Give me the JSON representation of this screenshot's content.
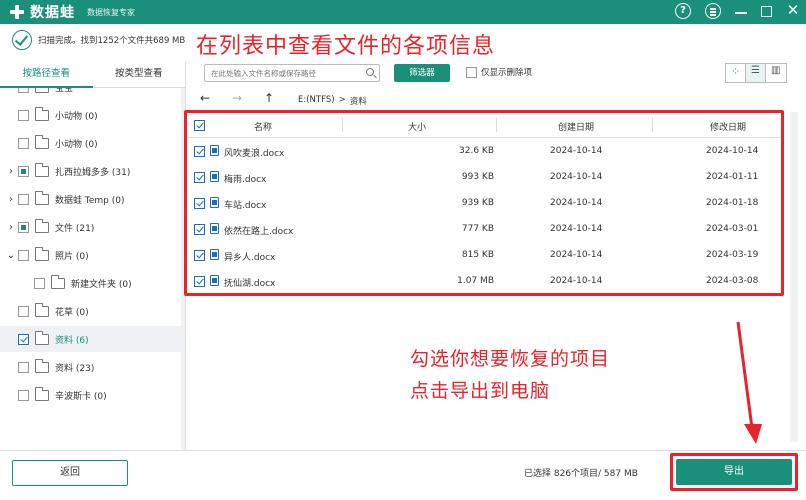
{
  "app": {
    "name": "数据蛙",
    "subtitle": "数据恢复专家"
  },
  "scan": {
    "status": "扫描完成。找到1252个文件共689 MB"
  },
  "annotations": {
    "top": "在列表中查看文件的各项信息",
    "line1": "勾选你想要恢复的项目",
    "line2": "点击导出到电脑"
  },
  "tabs": [
    {
      "label": "按路径查看",
      "active": true
    },
    {
      "label": "按类型查看",
      "active": false
    }
  ],
  "tree": [
    {
      "label": "宝宝",
      "arrow": "",
      "check": "none",
      "indent": 0
    },
    {
      "label": "小动物 (0)",
      "arrow": "",
      "check": "none",
      "indent": 0
    },
    {
      "label": "小动物 (0)",
      "arrow": "",
      "check": "none",
      "indent": 0
    },
    {
      "label": "扎西拉姆多多 (31)",
      "arrow": "›",
      "check": "partial",
      "indent": 0
    },
    {
      "label": "数据蛙 Temp (0)",
      "arrow": "›",
      "check": "none",
      "indent": 0
    },
    {
      "label": "文件 (21)",
      "arrow": "›",
      "check": "partial",
      "indent": 0
    },
    {
      "label": "照片 (0)",
      "arrow": "⌄",
      "check": "none",
      "indent": 0
    },
    {
      "label": "新建文件夹 (0)",
      "arrow": "",
      "check": "none",
      "indent": 1
    },
    {
      "label": "花草 (0)",
      "arrow": "",
      "check": "none",
      "indent": 0
    },
    {
      "label": "资料 (6)",
      "arrow": "",
      "check": "checked",
      "indent": 0,
      "selected": true
    },
    {
      "label": "资料 (23)",
      "arrow": "",
      "check": "none",
      "indent": 0
    },
    {
      "label": "辛波斯卡 (0)",
      "arrow": "",
      "check": "none",
      "indent": 0
    }
  ],
  "toolbar": {
    "search_placeholder": "在此处输入文件名称或保存路径",
    "filter_label": "筛选器",
    "deleted_only_label": "仅显示删除项"
  },
  "nav": {
    "back": "←",
    "forward": "→",
    "up": "↑",
    "path_root": "E:(NTFS)",
    "path_sep": ">",
    "path_current": "资料"
  },
  "table": {
    "columns": [
      "名称",
      "大小",
      "创建日期",
      "修改日期"
    ],
    "rows": [
      {
        "name": "风吹麦浪.docx",
        "size": "32.6 KB",
        "created": "2024-10-14",
        "modified": "2024-10-14"
      },
      {
        "name": "梅雨.docx",
        "size": "993 KB",
        "created": "2024-10-14",
        "modified": "2024-01-11"
      },
      {
        "name": "车站.docx",
        "size": "939 KB",
        "created": "2024-10-14",
        "modified": "2024-01-18"
      },
      {
        "name": "依然在路上.docx",
        "size": "777 KB",
        "created": "2024-10-14",
        "modified": "2024-03-01"
      },
      {
        "name": "异乡人.docx",
        "size": "815 KB",
        "created": "2024-10-14",
        "modified": "2024-03-19"
      },
      {
        "name": "抚仙湖.docx",
        "size": "1.07 MB",
        "created": "2024-10-14",
        "modified": "2024-03-08"
      }
    ]
  },
  "footer": {
    "back_label": "返回",
    "selected_info": "已选择 826个项目/ 587 MB",
    "export_label": "导出"
  },
  "colors": {
    "brand": "#1a8f7a",
    "annotation": "#e8232b"
  }
}
